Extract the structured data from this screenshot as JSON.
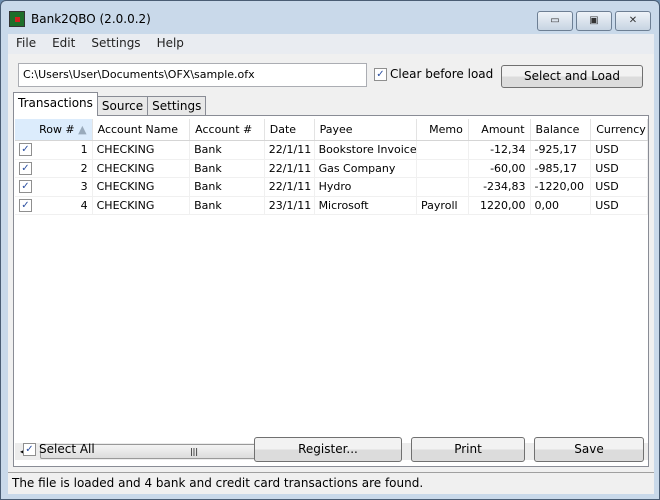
{
  "window": {
    "title": "Bank2QBO (2.0.0.2)",
    "minimize": "▭",
    "maximize": "▣",
    "close": "✕"
  },
  "menu": [
    "File",
    "Edit",
    "Settings",
    "Help"
  ],
  "file_path": "C:\\Users\\User\\Documents\\OFX\\sample.ofx",
  "clear_before_load": {
    "label": "Clear before load",
    "checked": true
  },
  "select_load_label": "Select and Load",
  "tabs": [
    "Transactions",
    "Source",
    "Settings"
  ],
  "active_tab": "Transactions",
  "table": {
    "columns": [
      "Row #",
      "Account Name",
      "Account #",
      "Date",
      "Payee",
      "Memo",
      "Amount",
      "Balance",
      "Currency"
    ],
    "sort_indicator": "▲",
    "rows": [
      {
        "checked": true,
        "cells": [
          "1",
          "CHECKING",
          "Bank",
          "22/1/11",
          "Bookstore Invoice",
          "",
          "-12,34",
          "-925,17",
          "USD"
        ]
      },
      {
        "checked": true,
        "cells": [
          "2",
          "CHECKING",
          "Bank",
          "22/1/11",
          "Gas Company",
          "",
          "-60,00",
          "-985,17",
          "USD"
        ]
      },
      {
        "checked": true,
        "cells": [
          "3",
          "CHECKING",
          "Bank",
          "22/1/11",
          "Hydro",
          "",
          "-234,83",
          "-1220,00",
          "USD"
        ]
      },
      {
        "checked": true,
        "cells": [
          "4",
          "CHECKING",
          "Bank",
          "23/1/11",
          "Microsoft",
          "Payroll",
          "1220,00",
          "0,00",
          "USD"
        ]
      }
    ]
  },
  "select_all": {
    "label": "Select All",
    "checked": true
  },
  "buttons": {
    "register": "Register...",
    "print": "Print",
    "save": "Save"
  },
  "status": "The file is loaded and 4 bank and credit card transactions are found."
}
